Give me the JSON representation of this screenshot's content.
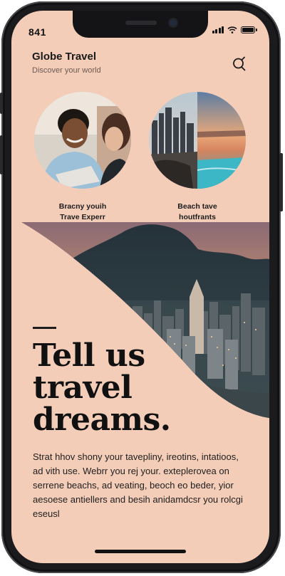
{
  "status": {
    "time": "841"
  },
  "header": {
    "title": "Globe Travel",
    "subtitle": "Discover your world"
  },
  "features": [
    {
      "line1": "Bracny youih",
      "line2": "Trave Experr"
    },
    {
      "line1": "Beach tave",
      "line2": "houtfrants"
    }
  ],
  "hero": {
    "headline": [
      "Tell us",
      "travel",
      "dreams."
    ],
    "body": "Strat hhov shony your tavepliny, ireotins, intatioos, ad vith use. Webrr you rej your. exteplerovea on serrene beachs, ad veating, beoch eo beder, yior aesoese antiellers and besih anidamdcsr you rolcgi eseusl"
  },
  "icons": {
    "search": "search-icon",
    "signal": "signal-icon",
    "wifi": "wifi-icon",
    "battery": "battery-icon"
  },
  "colors": {
    "background": "#f4cdb9",
    "text": "#111111",
    "frame": "#1b1b1d"
  }
}
